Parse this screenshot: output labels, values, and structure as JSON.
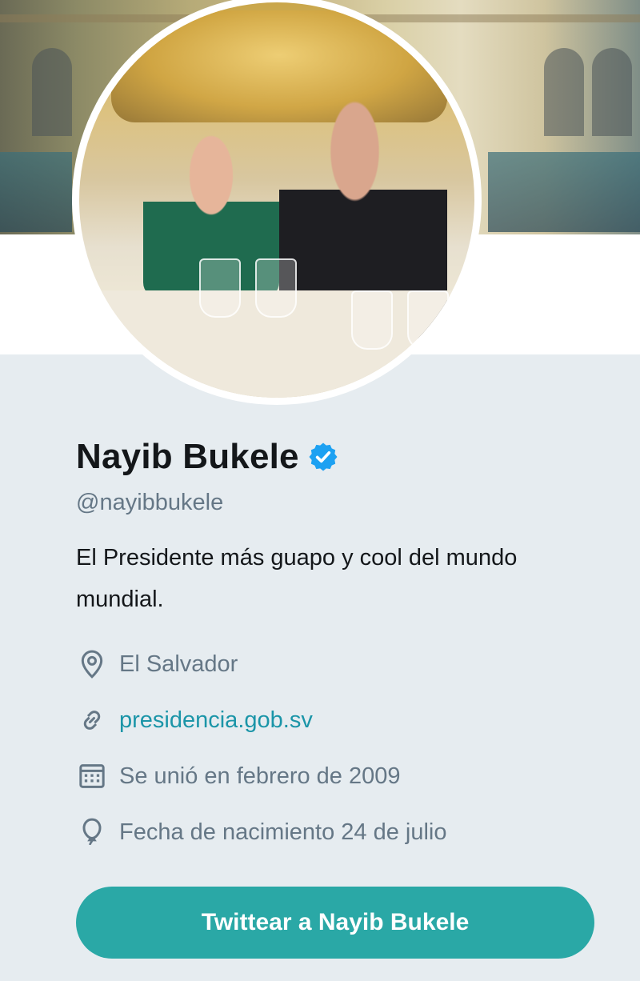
{
  "profile": {
    "name": "Nayib Bukele",
    "handle": "@nayibbukele",
    "bio": "El Presidente más guapo y cool del mundo mundial.",
    "verified_icon": "verified-badge-icon"
  },
  "meta": {
    "location": "El Salvador",
    "website": "presidencia.gob.sv",
    "joined": "Se unió en febrero de 2009",
    "birthday": "Fecha de nacimiento 24 de julio"
  },
  "actions": {
    "tweet_to_label": "Twittear a Nayib Bukele"
  },
  "colors": {
    "background": "#e6ecf0",
    "accent": "#2aa8a6",
    "link": "#1b95a8",
    "verified": "#1da1f2",
    "secondary_text": "#657786"
  }
}
